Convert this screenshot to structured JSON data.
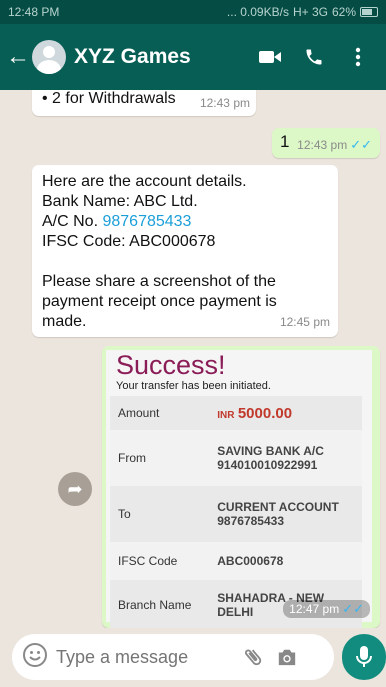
{
  "status_bar": {
    "time": "12:48 PM",
    "speed": "... 0.09KB/s",
    "network": "H+ 3G",
    "battery": "62%"
  },
  "header": {
    "contact_name": "XYZ Games",
    "back_icon": "back-arrow-icon",
    "video_icon": "video-call-icon",
    "call_icon": "phone-icon",
    "menu_icon": "more-vert-icon"
  },
  "messages": [
    {
      "direction": "in",
      "text": "• 2 for Withdrawals",
      "time": "12:43 pm"
    },
    {
      "direction": "out",
      "text": "1",
      "time": "12:43 pm",
      "ticks": "✓✓"
    },
    {
      "direction": "in",
      "lines": [
        "Here are the account details.",
        "Bank Name: ABC Ltd.",
        "A/C No.",
        "9876785433",
        "IFSC Code: ABC000678",
        "Please share a screenshot of the payment receipt once payment is made."
      ],
      "time": "12:45 pm"
    }
  ],
  "receipt": {
    "title": "Success!",
    "subtitle": "Your transfer has been initiated.",
    "rows": [
      {
        "label": "Amount",
        "currency": "INR",
        "value": "5000.00"
      },
      {
        "label": "From",
        "value_line1": "SAVING BANK A/C",
        "value_line2": "914010010922991"
      },
      {
        "label": "To",
        "value_line1": "CURRENT ACCOUNT",
        "value_line2": "9876785433"
      },
      {
        "label": "IFSC Code",
        "value": "ABC000678"
      },
      {
        "label": "Branch Name",
        "value_line1": "SHAHADRA - NEW",
        "value_line2": "DELHI"
      }
    ],
    "time": "12:47 pm",
    "ticks": "✓✓"
  },
  "input": {
    "placeholder": "Type a message",
    "emoji_icon": "emoji-icon",
    "attach_icon": "paperclip-icon",
    "camera_icon": "camera-icon",
    "mic_icon": "mic-icon"
  },
  "colors": {
    "header": "#075e54",
    "status_bar": "#054d44",
    "chat_bg": "#ece5dd",
    "outgoing_bubble": "#dcf8c6",
    "mic_button": "#128c7e",
    "link": "#1a9fd8",
    "success_title": "#8a1c57"
  }
}
